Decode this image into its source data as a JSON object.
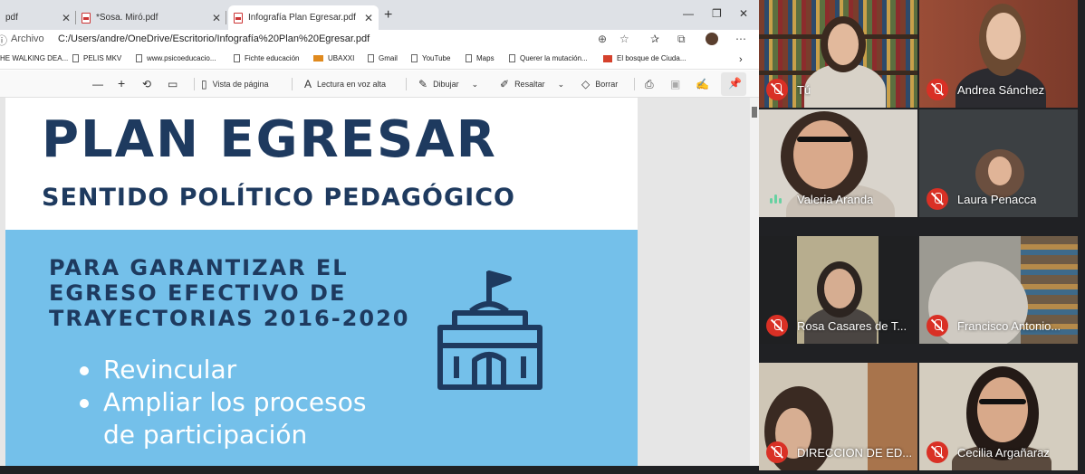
{
  "browser": {
    "tabs": [
      {
        "label": "pdf",
        "active": false
      },
      {
        "label": "*Sosa. Miró.pdf",
        "active": false
      },
      {
        "label": "Infografía Plan Egresar.pdf",
        "active": true
      }
    ],
    "new_tab": "+",
    "window_controls": {
      "minimize": "—",
      "restore": "❐",
      "close": "✕"
    },
    "address": {
      "label": "Archivo",
      "url": "C:/Users/andre/OneDrive/Escritorio/Infografía%20Plan%20Egresar.pdf"
    },
    "bookmarks": [
      "HE WALKING DEA...",
      "PELIS MKV",
      "www.psicoeducacio...",
      "Fichte educación",
      "UBAXXI",
      "Gmail",
      "YouTube",
      "Maps",
      "Querer la mutación...",
      "El bosque de Ciuda..."
    ],
    "pdf_toolbar": {
      "zoom_out": "—",
      "zoom_in": "+",
      "page_view": "Vista de página",
      "read_aloud": "Lectura en voz alta",
      "draw": "Dibujar",
      "highlight": "Resaltar",
      "erase": "Borrar"
    }
  },
  "document": {
    "title": "PLAN EGRESAR",
    "subtitle": "SENTIDO POLÍTICO PEDAGÓGICO",
    "heading_lines": [
      "PARA GARANTIZAR EL",
      "EGRESO EFECTIVO DE",
      "TRAYECTORIAS 2016-2020"
    ],
    "bullets": [
      {
        "first": "Revincular",
        "cont": ""
      },
      {
        "first": "Ampliar los procesos",
        "cont": "de participación"
      }
    ]
  },
  "meet": {
    "participants": [
      {
        "name": "Tú",
        "muted": true
      },
      {
        "name": "Andrea Sánchez",
        "muted": true
      },
      {
        "name": "Valeria Aranda",
        "muted": false,
        "speaking": true
      },
      {
        "name": "Laura Penacca",
        "muted": true
      },
      {
        "name": "Rosa Casares de T...",
        "muted": true
      },
      {
        "name": "Francisco Antonio...",
        "muted": true
      },
      {
        "name": "DIRECCION DE ED...",
        "muted": true
      },
      {
        "name": "Cecilia Argañaraz",
        "muted": true
      }
    ]
  },
  "colors": {
    "doc_navy": "#1e3a5f",
    "doc_blue": "#74c0ea",
    "meet_bg": "#202124",
    "mic_off": "#d93025",
    "speaking": "#66d1a1"
  }
}
